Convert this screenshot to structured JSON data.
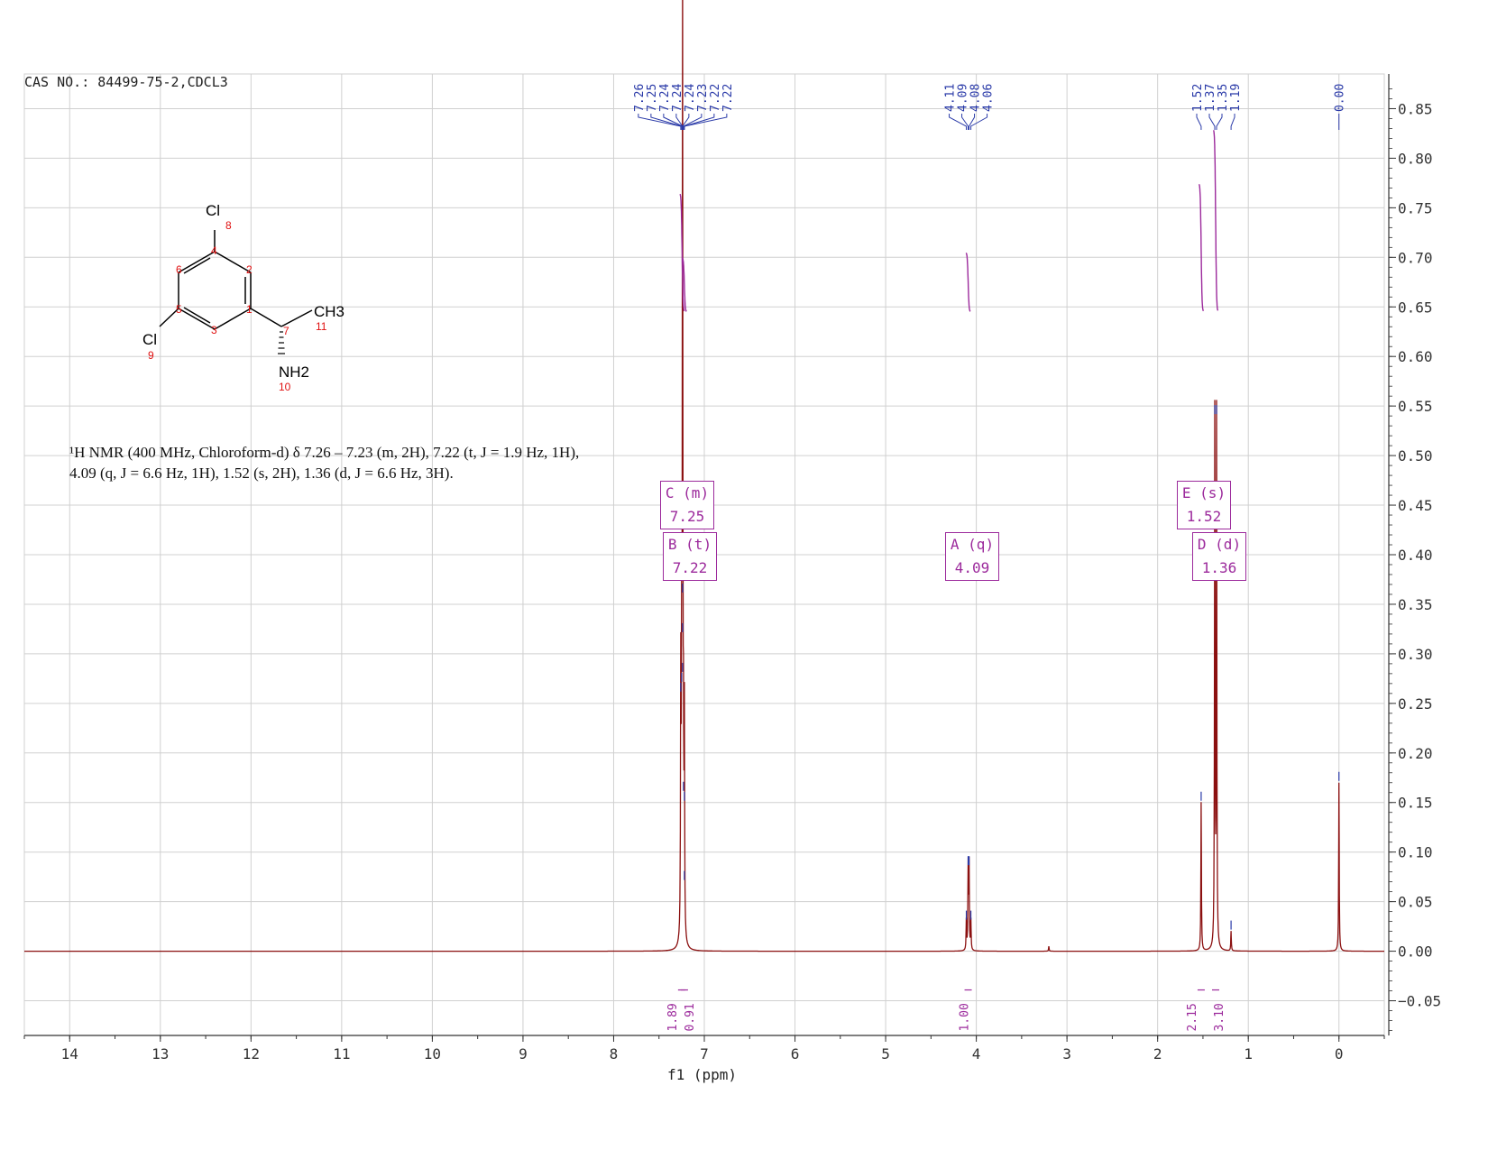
{
  "header": {
    "cas": "CAS NO.: 84499-75-2,CDCL3"
  },
  "description": {
    "line1": "¹H NMR (400 MHz, Chloroform-d) δ 7.26 – 7.23 (m, 2H), 7.22 (t, J = 1.9 Hz, 1H),",
    "line2": "4.09 (q, J = 6.6 Hz, 1H), 1.52 (s, 2H), 1.36 (d, J = 6.6 Hz, 3H)."
  },
  "structure": {
    "atoms": {
      "cl_top": "Cl",
      "cl_bottom": "Cl",
      "ch3": "CH3",
      "nh2": "NH2"
    },
    "numbers": [
      "1",
      "2",
      "3",
      "4",
      "5",
      "6",
      "7",
      "8",
      "9",
      "10",
      "11"
    ]
  },
  "multiplets": [
    {
      "id": "C",
      "mult": "m",
      "shift": "7.25",
      "line1": "C (m)",
      "line2": "7.25"
    },
    {
      "id": "B",
      "mult": "t",
      "shift": "7.22",
      "line1": "B (t)",
      "line2": "7.22"
    },
    {
      "id": "A",
      "mult": "q",
      "shift": "4.09",
      "line1": "A (q)",
      "line2": "4.09"
    },
    {
      "id": "E",
      "mult": "s",
      "shift": "1.52",
      "line1": "E (s)",
      "line2": "1.52"
    },
    {
      "id": "D",
      "mult": "d",
      "shift": "1.36",
      "line1": "D (d)",
      "line2": "1.36"
    }
  ],
  "colors": {
    "spectrum": "#8b1010",
    "peak_labels": "#2a3aa8",
    "integrals": "#9c2a9c",
    "grid": "#d0d0d0",
    "axis": "#333333"
  },
  "chart_data": {
    "type": "line",
    "title": "",
    "xlabel": "f1 (ppm)",
    "ylabel": "",
    "xlim": [
      14.5,
      -0.5
    ],
    "ylim": [
      -0.085,
      0.885
    ],
    "x_ticks": [
      "14",
      "13",
      "12",
      "11",
      "10",
      "9",
      "8",
      "7",
      "6",
      "5",
      "4",
      "3",
      "2",
      "1",
      "0"
    ],
    "y_ticks": [
      "0.85",
      "0.80",
      "0.75",
      "0.70",
      "0.65",
      "0.60",
      "0.55",
      "0.50",
      "0.45",
      "0.40",
      "0.35",
      "0.30",
      "0.25",
      "0.20",
      "0.15",
      "0.10",
      "0.05",
      "0.00",
      "-0.05"
    ],
    "grid": true,
    "peaks": [
      {
        "x": 7.26,
        "y": 0.26
      },
      {
        "x": 7.25,
        "y": 0.27
      },
      {
        "x": 7.24,
        "y": 0.36
      },
      {
        "x": 7.24,
        "y": 0.32
      },
      {
        "x": 7.24,
        "y": 0.28
      },
      {
        "x": 7.23,
        "y": 0.16
      },
      {
        "x": 7.22,
        "y": 0.15
      },
      {
        "x": 7.22,
        "y": 0.07
      },
      {
        "x": 4.11,
        "y": 0.03
      },
      {
        "x": 4.09,
        "y": 0.085
      },
      {
        "x": 4.08,
        "y": 0.085
      },
      {
        "x": 4.06,
        "y": 0.03
      },
      {
        "x": 1.52,
        "y": 0.15
      },
      {
        "x": 1.37,
        "y": 0.54
      },
      {
        "x": 1.35,
        "y": 0.54
      },
      {
        "x": 1.19,
        "y": 0.02
      },
      {
        "x": 0.0,
        "y": 0.17
      },
      {
        "x": 3.2,
        "y": 0.005
      }
    ],
    "peak_labels": [
      "7.26",
      "7.25",
      "7.24",
      "7.24",
      "7.24",
      "7.23",
      "7.22",
      "7.22",
      "4.11",
      "4.09",
      "4.08",
      "4.06",
      "1.52",
      "1.37",
      "1.35",
      "1.19",
      "0.00"
    ],
    "integrals": [
      {
        "label": "1.89",
        "center": 7.25
      },
      {
        "label": "0.91",
        "center": 7.22
      },
      {
        "label": "1.00",
        "center": 4.09
      },
      {
        "label": "2.15",
        "center": 1.52
      },
      {
        "label": "3.10",
        "center": 1.36
      }
    ]
  }
}
